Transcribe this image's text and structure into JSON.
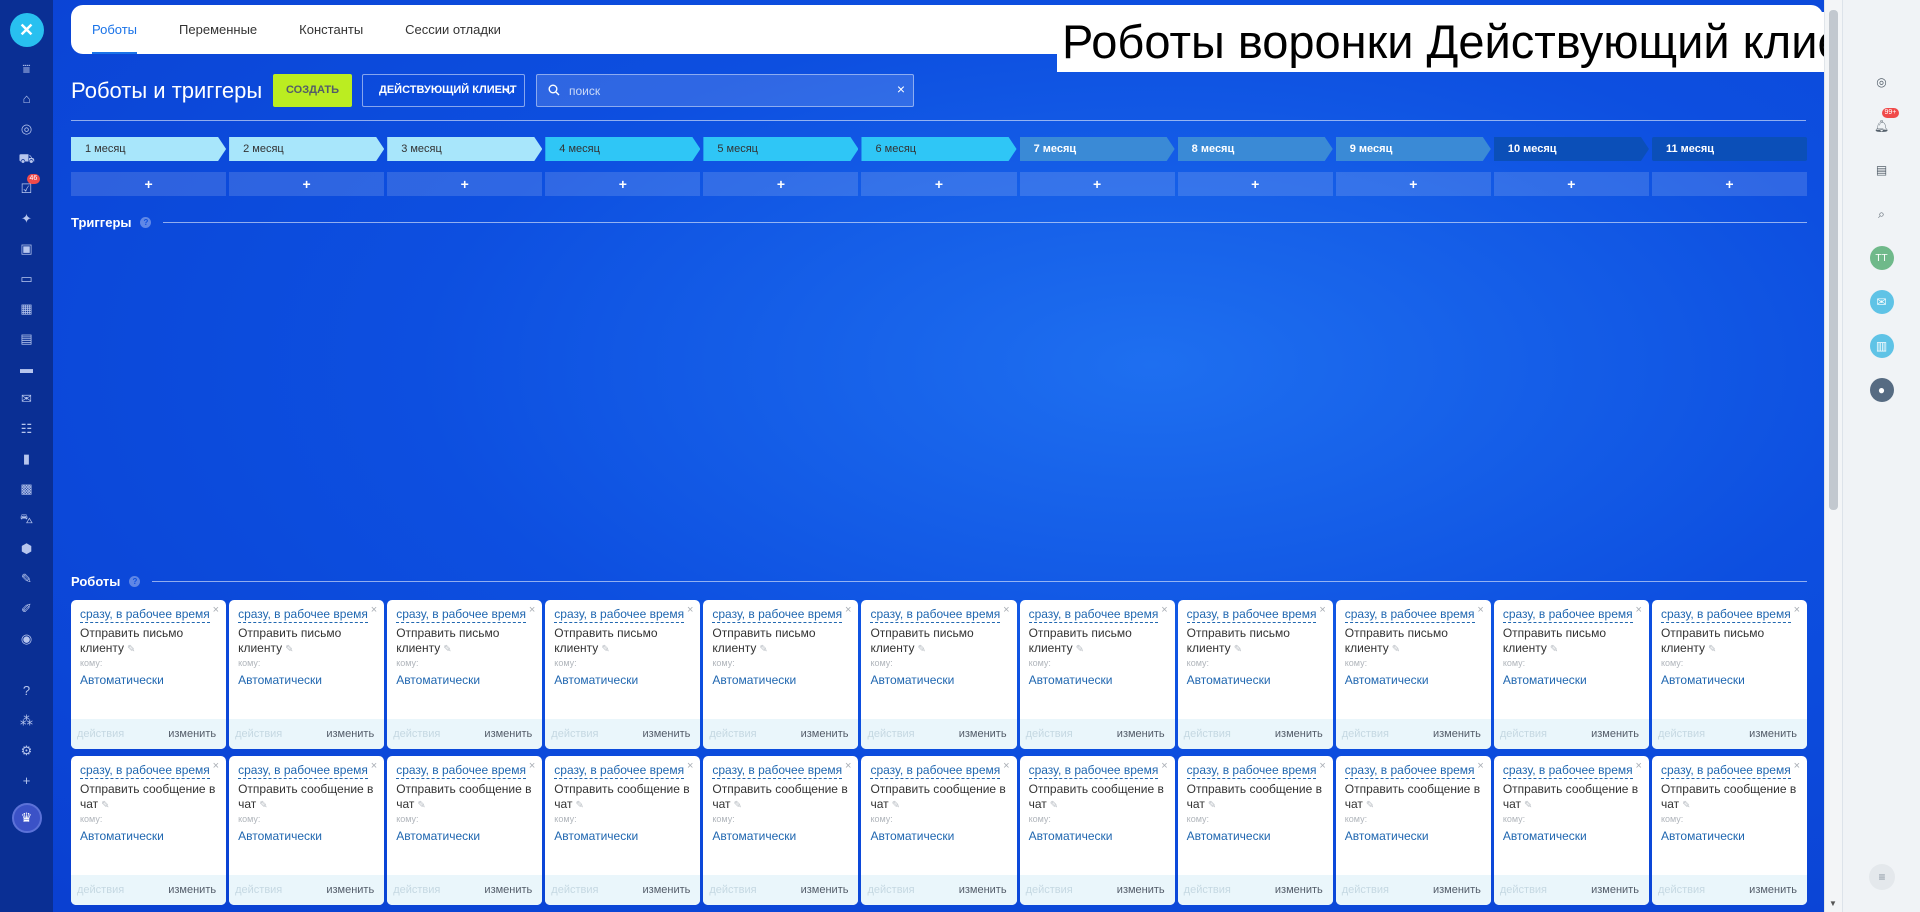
{
  "overlay_title": "Роботы воронки Действующий клиент",
  "tabs": [
    {
      "label": "Роботы",
      "active": true
    },
    {
      "label": "Переменные",
      "active": false
    },
    {
      "label": "Константы",
      "active": false
    },
    {
      "label": "Сессии отладки",
      "active": false
    }
  ],
  "toolbar": {
    "title": "Роботы и триггеры",
    "create_label": "СОЗДАТЬ",
    "funnel_label": "ДЕЙСТВУЮЩИЙ КЛИЕНТ",
    "search_placeholder": "поиск"
  },
  "stages": [
    {
      "label": "1 месяц",
      "color": "#a8e6fb",
      "text_color": "#333333"
    },
    {
      "label": "2 месяц",
      "color": "#a8e6fb",
      "text_color": "#333333"
    },
    {
      "label": "3 месяц",
      "color": "#a8e6fb",
      "text_color": "#333333"
    },
    {
      "label": "4 месяц",
      "color": "#2fc6f6",
      "text_color": "#333333"
    },
    {
      "label": "5 месяц",
      "color": "#2fc6f6",
      "text_color": "#333333"
    },
    {
      "label": "6 месяц",
      "color": "#2fc6f6",
      "text_color": "#333333"
    },
    {
      "label": "7 месяц",
      "color": "#3a8ad6",
      "text_color": "#ffffff"
    },
    {
      "label": "8 месяц",
      "color": "#3a8ad6",
      "text_color": "#ffffff"
    },
    {
      "label": "9 месяц",
      "color": "#3a8ad6",
      "text_color": "#ffffff"
    },
    {
      "label": "10 месяц",
      "color": "#0b4fb8",
      "text_color": "#ffffff"
    },
    {
      "label": "11 месяц",
      "color": "#0b4fb8",
      "text_color": "#ffffff"
    }
  ],
  "plus_label": "+",
  "sections": {
    "triggers_label": "Триггеры",
    "robots_label": "Роботы",
    "help_glyph": "?"
  },
  "robot_rows": [
    {
      "when": "сразу, в рабочее время",
      "name": "Отправить письмо клиенту",
      "to_label": "кому:",
      "auto_label": "Автоматически",
      "actions_label": "действия",
      "edit_label": "изменить",
      "close_glyph": "×"
    },
    {
      "when": "сразу, в рабочее время",
      "name": "Отправить сообщение в чат",
      "to_label": "кому:",
      "auto_label": "Автоматически",
      "actions_label": "действия",
      "edit_label": "изменить",
      "close_glyph": "×"
    }
  ],
  "left_sidebar": {
    "icons": [
      "filter-icon",
      "home-icon",
      "target-icon",
      "cart-icon",
      "tasks-icon",
      "puzzle-icon",
      "document-icon",
      "chat-icon",
      "calendar-icon",
      "file-icon",
      "storage-icon",
      "mail-icon",
      "group-icon",
      "chart-icon",
      "contact-card-icon",
      "truck-icon",
      "box-icon",
      "sign-icon",
      "pen-icon",
      "check-icon",
      "question-icon",
      "sitemap-icon",
      "gear-icon",
      "plus-icon"
    ],
    "tasks_badge": "46"
  },
  "right_sidebar": {
    "notification_badge": "99+",
    "avatar_initials": "TT"
  },
  "colors": {
    "accent_blue": "#1a73e8",
    "create_button": "#bbed21",
    "link_blue": "#2067b0"
  }
}
